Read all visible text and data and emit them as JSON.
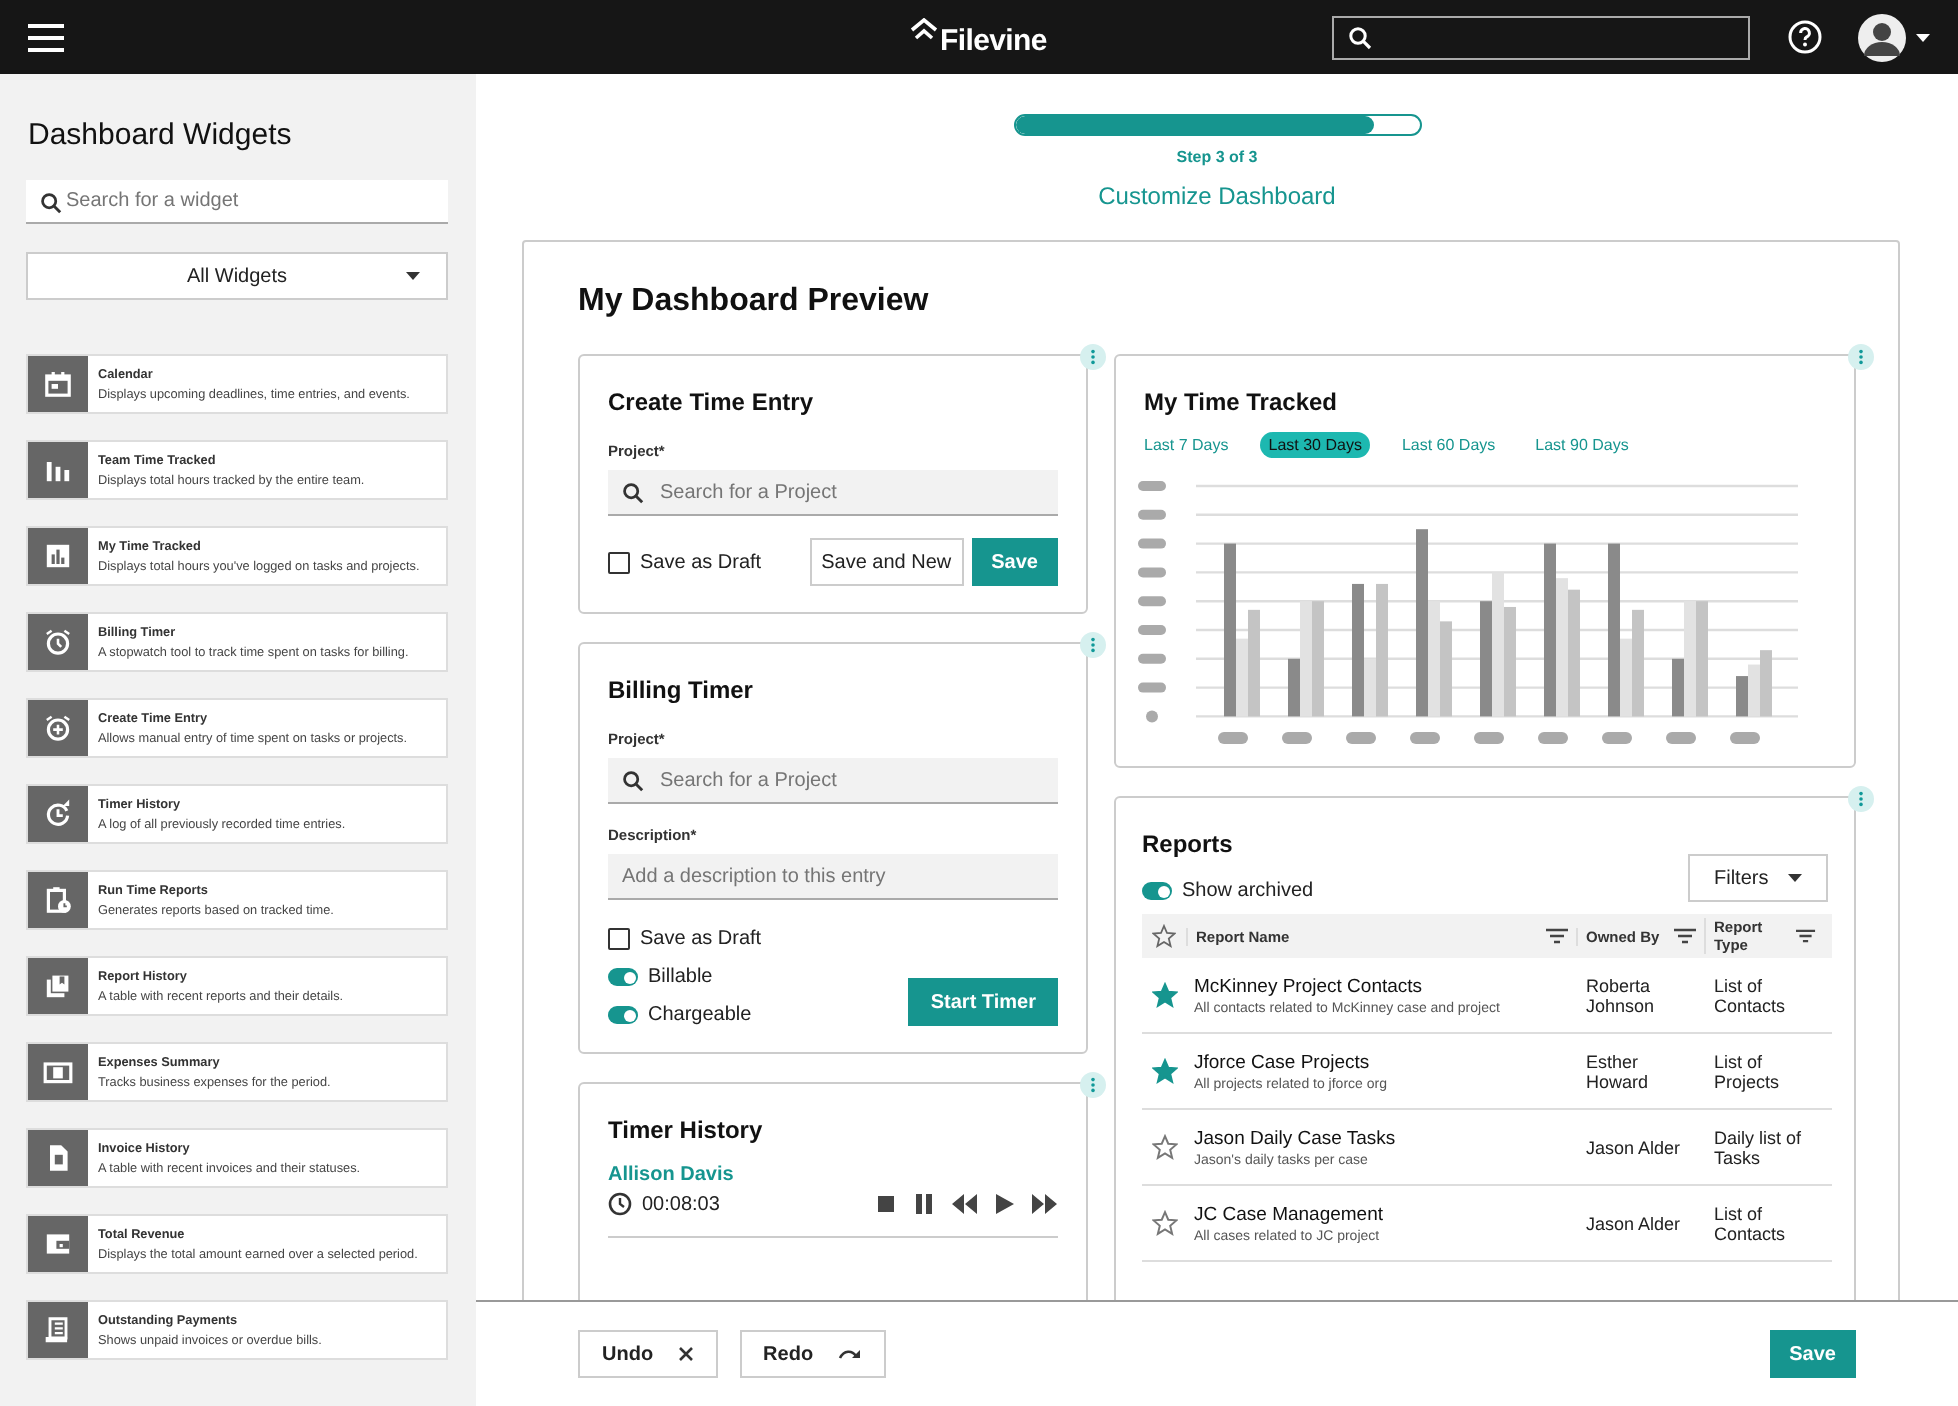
{
  "header": {
    "logo": "Filevine"
  },
  "sidebar": {
    "title": "Dashboard Widgets",
    "search": {
      "placeholder": "Search for a widget"
    },
    "filter": "All Widgets",
    "widgets": [
      {
        "name": "Calendar",
        "description": "Displays upcoming deadlines, time entries, and events."
      },
      {
        "name": "Team Time Tracked",
        "description": "Displays total hours tracked by the entire team."
      },
      {
        "name": "My Time Tracked",
        "description": "Displays total hours you've logged on tasks and projects."
      },
      {
        "name": "Billing Timer",
        "description": "A stopwatch tool to track time spent on tasks for billing."
      },
      {
        "name": "Create Time Entry",
        "description": "Allows manual entry of time spent on tasks or projects."
      },
      {
        "name": "Timer History",
        "description": "A log of all previously recorded time entries."
      },
      {
        "name": "Run Time Reports",
        "description": "Generates reports based on tracked time."
      },
      {
        "name": "Report History",
        "description": "A table with recent reports and their details."
      },
      {
        "name": "Expenses Summary",
        "description": "Tracks business expenses for the period."
      },
      {
        "name": "Invoice History",
        "description": "A table with recent invoices and their statuses."
      },
      {
        "name": "Total Revenue",
        "description": "Displays the total amount earned over a selected period."
      },
      {
        "name": "Outstanding Payments",
        "description": "Shows unpaid invoices or overdue bills."
      }
    ]
  },
  "stepper": {
    "level": 0.89,
    "step": "Step 3 of 3",
    "title": "Customize Dashboard"
  },
  "preview": {
    "title": "My Dashboard Preview",
    "create_time_entry": {
      "title": "Create Time Entry",
      "project_label": "Project*",
      "project": {
        "placeholder": "Search for a Project"
      },
      "draft": {
        "label": "Save as Draft",
        "checked": false
      },
      "buttons": [
        "Save and New",
        "Save"
      ]
    },
    "billing_timer": {
      "title": "Billing Timer",
      "project_label": "Project*",
      "project": {
        "placeholder": "Search for a Project"
      },
      "description_label": "Description*",
      "description": {
        "placeholder": "Add a description to this entry"
      },
      "draft": {
        "label": "Save as Draft",
        "checked": false
      },
      "toggles": [
        {
          "label": "Billable",
          "on": true
        },
        {
          "label": "Chargeable",
          "on": true
        }
      ],
      "button": "Start Timer"
    },
    "timer_history": {
      "title": "Timer History",
      "name": "Allison Davis",
      "time": "00:08:03"
    },
    "my_time_tracked": {
      "title": "My Time Tracked",
      "ranges": [
        {
          "label": "Last 7 Days",
          "selected": false
        },
        {
          "label": "Last 30 Days",
          "selected": true
        },
        {
          "label": "Last 60 Days",
          "selected": false
        },
        {
          "label": "Last 90 Days",
          "selected": false
        }
      ]
    },
    "reports": {
      "title": "Reports",
      "show_archived": {
        "label": "Show archived",
        "on": true
      },
      "filters": "Filters",
      "columns": [
        "Report Name",
        "Owned By",
        "Report Type"
      ],
      "rows": [
        {
          "starred": true,
          "name": "McKinney Project Contacts",
          "description": "All contacts related to McKinney case and project",
          "owner": "Roberta Johnson",
          "type": "List of Contacts"
        },
        {
          "starred": true,
          "name": "Jforce Case Projects",
          "description": "All projects related to jforce org",
          "owner": "Esther Howard",
          "type": "List of Projects"
        },
        {
          "starred": false,
          "name": "Jason Daily Case Tasks",
          "description": "Jason's daily tasks per case",
          "owner": "Jason Alder",
          "type": "Daily list of Tasks"
        },
        {
          "starred": false,
          "name": "JC Case Management",
          "description": "All cases related to JC project",
          "owner": "Jason Alder",
          "type": "List of Contacts"
        }
      ]
    }
  },
  "footer": {
    "undo": "Undo",
    "redo": "Redo",
    "save": "Save"
  }
}
